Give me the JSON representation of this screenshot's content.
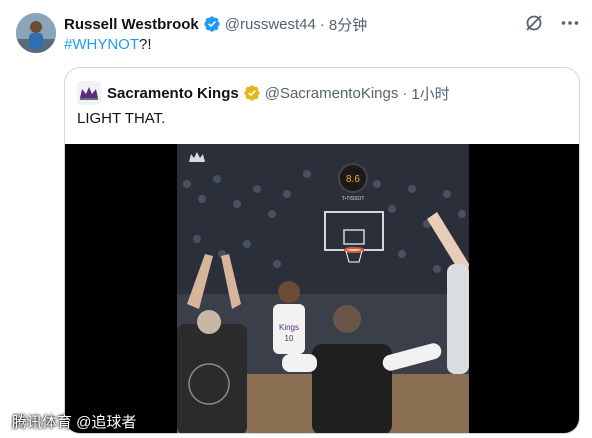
{
  "tweet": {
    "author_name": "Russell Westbrook",
    "handle": "@russwest44",
    "separator": "·",
    "time": "8分钟",
    "text_hashtag": "#WHYNOT",
    "text_suffix": "?!"
  },
  "quote": {
    "author_name": "Sacramento Kings",
    "handle": "@SacramentoKings",
    "separator": "·",
    "time": "1小时",
    "text": "LIGHT THAT."
  },
  "media": {
    "shot_clock": "8.6",
    "sponsor": "T•TISSOT",
    "jersey_team": "Kings",
    "jersey_number": "10"
  },
  "watermark": "腾讯体育 @追球者",
  "colors": {
    "accent": "#1d9bf0",
    "verified_blue": "#1d9bf0",
    "verified_gold": "#e2b719",
    "secondary_text": "#536471",
    "border": "#cfd9de"
  },
  "icons": [
    "verified-badge-icon",
    "grok-icon",
    "more-icon",
    "kings-logo-icon"
  ]
}
